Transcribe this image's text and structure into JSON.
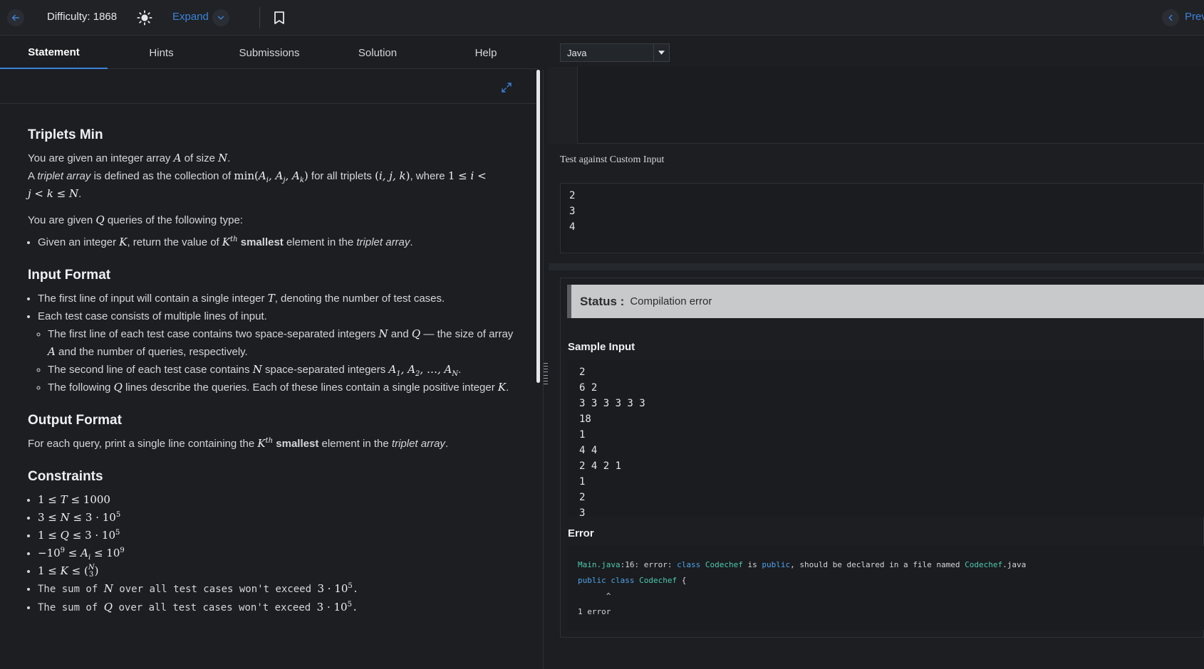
{
  "topbar": {
    "difficulty": "Difficulty: 1868",
    "expand_label": "Expand",
    "prev_label": "Prev"
  },
  "tabs": [
    {
      "label": "Statement",
      "active": true
    },
    {
      "label": "Hints"
    },
    {
      "label": "Submissions"
    },
    {
      "label": "Solution"
    },
    {
      "label": "Help"
    }
  ],
  "language": "Java",
  "problem": {
    "title": "Triplets Min",
    "p1": "You are given an integer array",
    "p1b": "of size",
    "p2a": "A",
    "p2b": "triplet array",
    "p2c": "is defined as the collection of",
    "p2d": "for all triplets",
    "p2e": ", where",
    "p3a": "You are given",
    "p3b": "queries of the following type:",
    "bullet1a": "Given an integer",
    "bullet1b": ", return the value of",
    "bullet1c": "smallest",
    "bullet1d": "element in the",
    "bullet1e": "triplet array",
    "input_title": "Input Format",
    "in1a": "The first line of input will contain a single integer",
    "in1b": ", denoting the number of test cases.",
    "in2": "Each test case consists of multiple lines of input.",
    "in3a": "The first line of each test case contains two space-separated integers",
    "in3b": "and",
    "in3c": "— the size of array",
    "in3d": "and the number of queries, respectively.",
    "in4a": "The second line of each test case contains",
    "in4b": "space-separated integers",
    "in5a": "The following",
    "in5b": "lines describe the queries. Each of these lines contain a single positive integer",
    "output_title": "Output Format",
    "out1a": "For each query, print a single line containing the",
    "out1b": "smallest",
    "out1c": "element in the",
    "out1d": "triplet array",
    "constraints_title": "Constraints",
    "c6a": "The sum of",
    "c6b": "over all test cases won't exceed",
    "c7a": "The sum of",
    "c7b": "over all test cases won't exceed"
  },
  "custom_input": {
    "label": "Test against Custom Input",
    "value": "2\n3\n4"
  },
  "result": {
    "status_label": "Status :",
    "status_value": "Compilation error",
    "sample_label": "Sample Input",
    "sample_value": "2\n6 2\n3 3 3 3 3 3\n18\n1\n4 4\n2 4 2 1\n1\n2\n3",
    "error_label": "Error",
    "error_line1_file": "Main.java",
    "error_line1_mid": ":16: error: ",
    "error_line1_kw1": "class",
    "error_line1_cls": "Codechef",
    "error_line1_is": " is ",
    "error_line1_kw2": "public",
    "error_line1_rest": ", should be declared in a file named ",
    "error_line1_file2": "Codechef",
    "error_line1_ext": ".java",
    "error_line2_kw": "public class",
    "error_line2_cls": "Codechef",
    "error_line2_rest": " {",
    "error_line3": "      ^",
    "error_line4": "1 error"
  }
}
